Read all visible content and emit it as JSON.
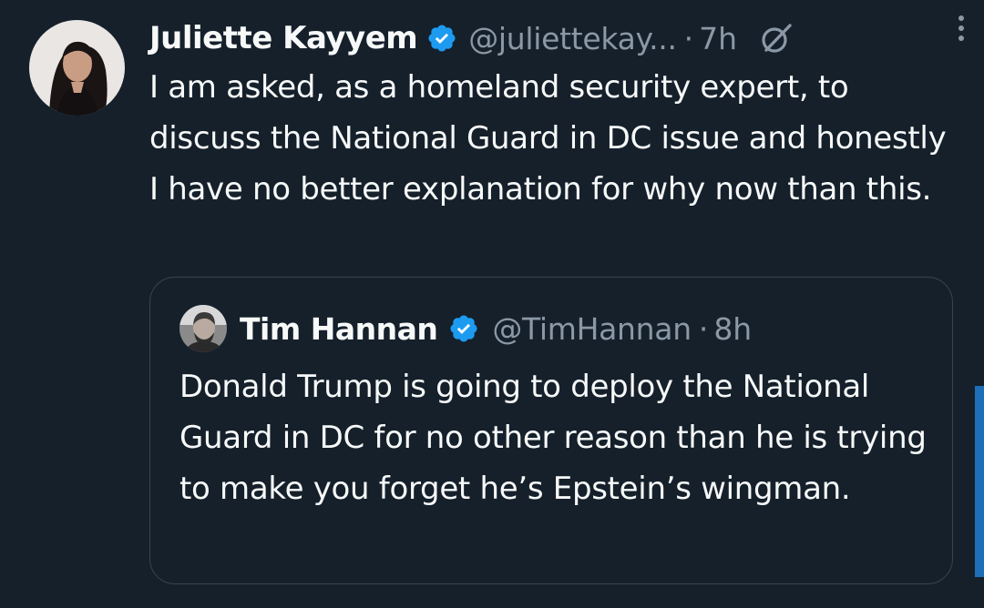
{
  "tweet": {
    "author_name": "Juliette Kayyem",
    "author_handle": "@juliettekay...",
    "separator": "·",
    "time": "7h",
    "text": "I am asked, as a homeland security expert, to discuss the National Guard in DC issue and honestly I have no better explanation for why now than this.",
    "verified_icon": "verified-badge-icon",
    "grok_icon": "grok-icon",
    "more_icon": "more-vertical-icon"
  },
  "quoted_tweet": {
    "author_name": "Tim Hannan",
    "author_handle": "@TimHannan",
    "separator": "·",
    "time": "8h",
    "text": "Donald Trump is going to deploy the National Guard in DC for no other reason than he is trying to make you forget he’s Epstein’s wingman."
  },
  "colors": {
    "background": "#15202b",
    "primary_text": "#f7f9f9",
    "secondary_text": "#8b98a5",
    "verified_blue": "#1d9bf0",
    "border": "#38444d"
  }
}
